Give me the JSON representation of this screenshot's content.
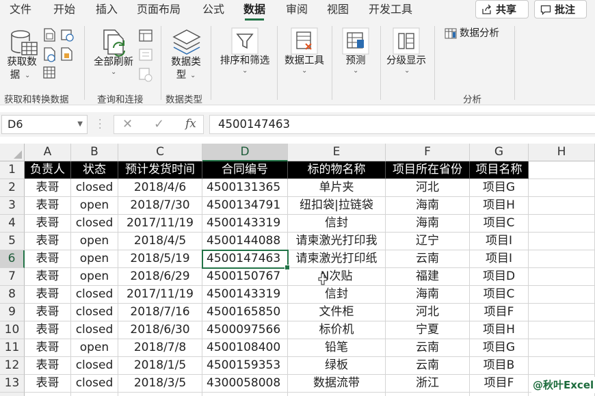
{
  "ribbon_tabs": [
    "文件",
    "开始",
    "插入",
    "页面布局",
    "公式",
    "数据",
    "审阅",
    "视图",
    "开发工具"
  ],
  "active_tab": "数据",
  "share_label": "共享",
  "comments_label": "批注",
  "groups": {
    "get_transform": {
      "label": "获取和转换数据",
      "get_data_line1": "获取数",
      "get_data_line2": "据"
    },
    "queries": {
      "label": "查询和连接",
      "refresh_all": "全部刷新"
    },
    "data_types": {
      "label": "数据类型",
      "data_type_line1": "数据类",
      "data_type_line2": "型"
    },
    "sort_filter": "排序和筛选",
    "data_tools": "数据工具",
    "forecast": "预测",
    "outline": "分级显示",
    "analysis": {
      "label": "分析",
      "data_analysis": "数据分析"
    }
  },
  "formula_bar": {
    "name_box": "D6",
    "fx": "fx",
    "value": "4500147463"
  },
  "sheet": {
    "columns": [
      "A",
      "B",
      "C",
      "D",
      "E",
      "F",
      "G",
      "H"
    ],
    "selected_column": "D",
    "selected_row": 6,
    "header": [
      "负责人",
      "状态",
      "预计发货时间",
      "合同编号",
      "标的物名称",
      "项目所在省份",
      "项目名称"
    ],
    "rows": [
      [
        "表哥",
        "closed",
        "2018/4/6",
        "4500131365",
        "单片夹",
        "河北",
        "项目G"
      ],
      [
        "表哥",
        "open",
        "2018/7/30",
        "4500134791",
        "纽扣袋|拉链袋",
        "海南",
        "项目H"
      ],
      [
        "表哥",
        "closed",
        "2017/11/19",
        "4500143319",
        "信封",
        "海南",
        "项目C"
      ],
      [
        "表哥",
        "open",
        "2018/4/5",
        "4500144088",
        "请柬激光打印我",
        "辽宁",
        "项目I"
      ],
      [
        "表哥",
        "open",
        "2018/5/19",
        "4500147463",
        "请柬激光打印纸",
        "云南",
        "项目I"
      ],
      [
        "表哥",
        "open",
        "2018/6/29",
        "4500150767",
        "N次贴",
        "福建",
        "项目D"
      ],
      [
        "表哥",
        "closed",
        "2017/11/19",
        "4500143319",
        "信封",
        "海南",
        "项目C"
      ],
      [
        "表哥",
        "closed",
        "2018/7/16",
        "4500165850",
        "文件柜",
        "河北",
        "项目F"
      ],
      [
        "表哥",
        "closed",
        "2018/6/30",
        "4500097566",
        "标价机",
        "宁夏",
        "项目H"
      ],
      [
        "表哥",
        "open",
        "2018/7/8",
        "4500108400",
        "铅笔",
        "云南",
        "项目G"
      ],
      [
        "表哥",
        "closed",
        "2018/1/5",
        "4500159353",
        "绿板",
        "云南",
        "项目B"
      ],
      [
        "表哥",
        "closed",
        "2018/3/5",
        "4300058008",
        "数据流带",
        "浙江",
        "项目F"
      ]
    ]
  },
  "watermark": "@秋叶Excel"
}
